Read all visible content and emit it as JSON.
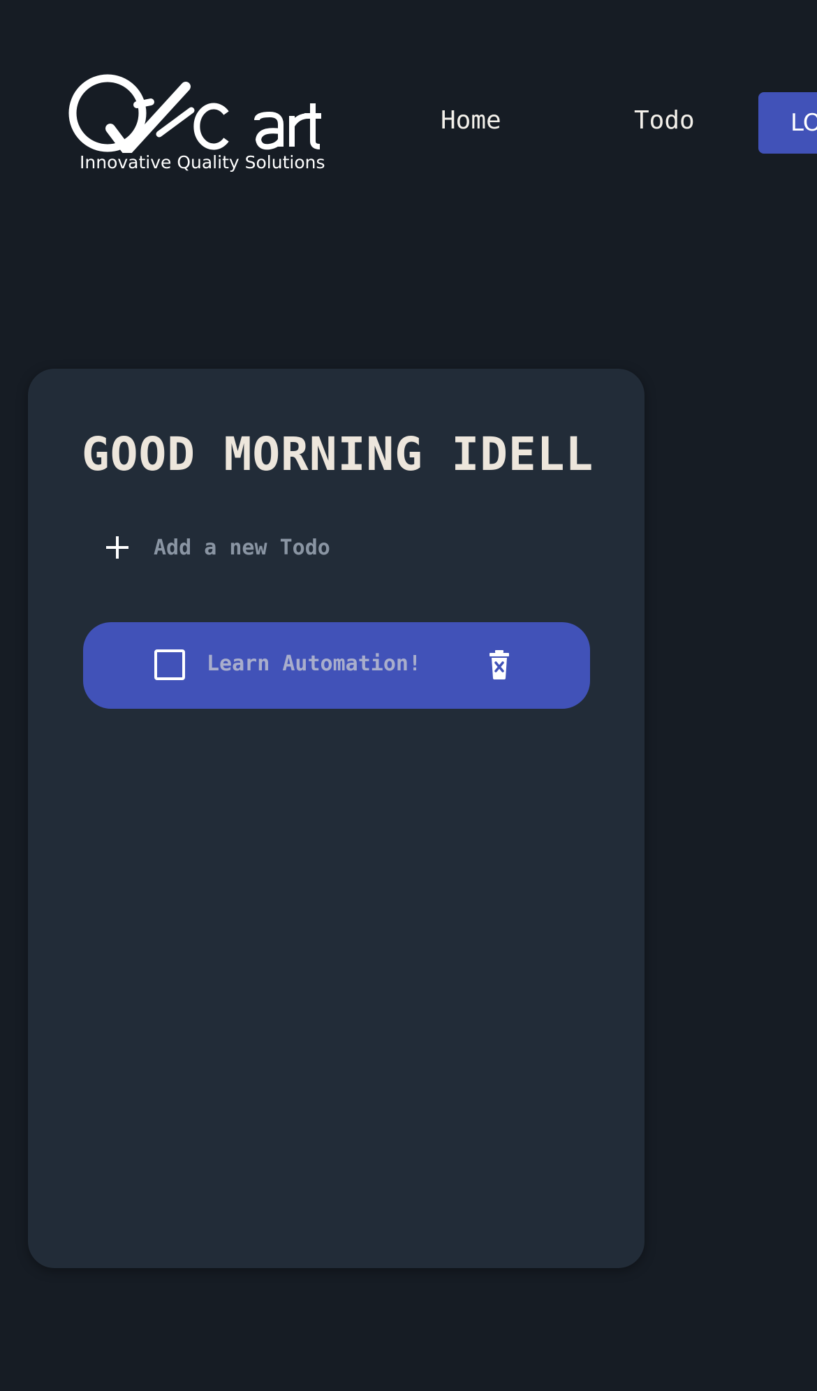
{
  "header": {
    "logo_text": "QACart",
    "logo_tagline": "Innovative Quality Solutions",
    "nav": [
      {
        "label": "Home"
      },
      {
        "label": "Todo"
      }
    ],
    "logout_label": "LOGOUT"
  },
  "todo_panel": {
    "greeting": "GOOD MORNING IDELL",
    "new_todo_placeholder": "Add a new Todo",
    "items": [
      {
        "text": "Learn Automation!",
        "completed": false
      }
    ]
  },
  "colors": {
    "page_background": "#161c24",
    "card_background": "#222c38",
    "accent": "#4152b8",
    "greeting_text": "#ede6dc"
  },
  "icons": {
    "add": "plus-icon",
    "delete": "trash-icon",
    "complete": "checkbox-icon"
  }
}
